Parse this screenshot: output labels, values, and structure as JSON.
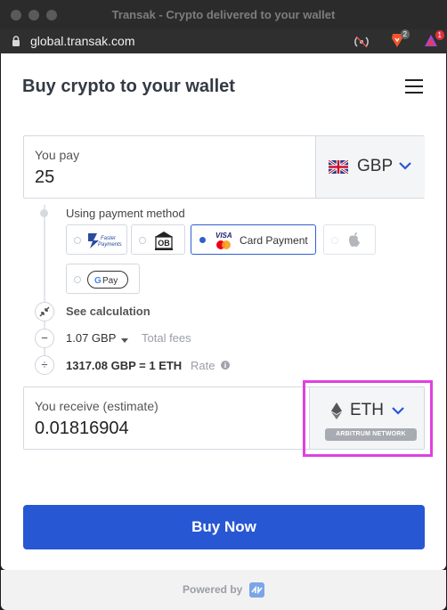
{
  "window": {
    "title": "Transak - Crypto delivered to your wallet"
  },
  "browser": {
    "url": "global.transak.com",
    "brave_badge": "2",
    "alert_badge": "1"
  },
  "header": {
    "title": "Buy crypto to your wallet"
  },
  "pay": {
    "label": "You pay",
    "amount": "25",
    "currency": "GBP"
  },
  "payment": {
    "label": "Using payment method",
    "card_label": "Card Payment",
    "visa_text": "VISA",
    "fp_text_1": "Faster",
    "fp_text_2": "Payments",
    "ob_text": "OB",
    "gpay_text": "Pay",
    "gpay_g": "G",
    "selected": "Card Payment"
  },
  "calc": {
    "see_calculation": "See calculation",
    "fees_value": "1.07 GBP",
    "fees_label": "Total fees",
    "rate_value": "1317.08 GBP = 1 ETH",
    "rate_label": "Rate"
  },
  "receive": {
    "label": "You receive (estimate)",
    "amount": "0.01816904",
    "currency": "ETH",
    "network": "ARBITRUM NETWORK"
  },
  "actions": {
    "buy_label": "Buy Now"
  },
  "footer": {
    "powered_by": "Powered by"
  },
  "colors": {
    "primary": "#2757d3",
    "highlight": "#e040e0"
  }
}
